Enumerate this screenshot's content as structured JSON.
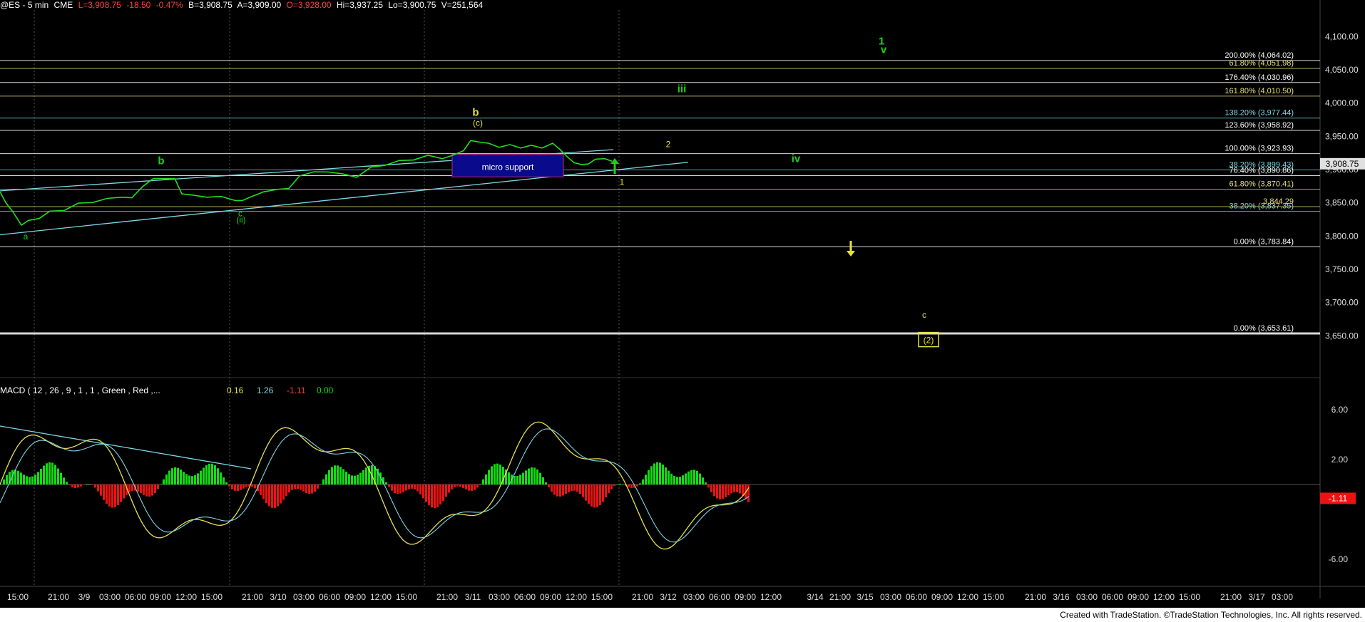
{
  "header": {
    "symbol": "@ES - 5 min",
    "exchange": "CME",
    "last": "L=3,908.75",
    "change": "-18.50",
    "change_pct": "-0.47%",
    "bid": "B=3,908.75",
    "ask": "A=3,909.00",
    "open": "O=3,928.00",
    "high": "Hi=3,937.25",
    "low": "Lo=3,900.75",
    "volume": "V=251,564"
  },
  "footer": {
    "credit": "Created with TradeStation. ©TradeStation Technologies, Inc. All rights reserved."
  },
  "colors": {
    "price": "#22dd22",
    "fib_white": "#ffffff",
    "fib_yellow": "#e8e07a",
    "fib_cyan": "#7fd6e6",
    "label_yellow": "#e8e03a",
    "label_green": "#1fcf1f",
    "macd_pos": "#11dd11",
    "macd_neg": "#ee1111",
    "support_box": "#0a0a8c",
    "support_border": "#c0306a"
  },
  "chart_data": [
    {
      "type": "line",
      "name": "price-panel",
      "ylim": [
        3600,
        4140
      ],
      "y_ticks": [
        "4,100.00",
        "4,050.00",
        "4,000.00",
        "3,950.00",
        "3,900.00",
        "3,850.00",
        "3,800.00",
        "3,750.00",
        "3,700.00",
        "3,650.00"
      ],
      "y_tick_values": [
        4100,
        4050,
        4000,
        3950,
        3900,
        3850,
        3800,
        3750,
        3700,
        3650
      ],
      "last_price_tag": "3,908.75",
      "price_series": [
        [
          0,
          3865
        ],
        [
          8,
          3852
        ],
        [
          18,
          3835
        ],
        [
          30,
          3818
        ],
        [
          40,
          3822
        ],
        [
          55,
          3828
        ],
        [
          70,
          3836
        ],
        [
          90,
          3840
        ],
        [
          110,
          3848
        ],
        [
          130,
          3852
        ],
        [
          150,
          3855
        ],
        [
          170,
          3860
        ],
        [
          185,
          3856
        ],
        [
          200,
          3876
        ],
        [
          215,
          3885
        ],
        [
          230,
          3888
        ],
        [
          245,
          3885
        ],
        [
          255,
          3865
        ],
        [
          270,
          3860
        ],
        [
          290,
          3860
        ],
        [
          310,
          3858
        ],
        [
          330,
          3855
        ],
        [
          340,
          3852
        ],
        [
          355,
          3862
        ],
        [
          370,
          3865
        ],
        [
          390,
          3872
        ],
        [
          405,
          3870
        ],
        [
          420,
          3892
        ],
        [
          440,
          3895
        ],
        [
          460,
          3898
        ],
        [
          480,
          3892
        ],
        [
          500,
          3890
        ],
        [
          520,
          3902
        ],
        [
          540,
          3908
        ],
        [
          560,
          3912
        ],
        [
          580,
          3916
        ],
        [
          600,
          3920
        ],
        [
          620,
          3918
        ],
        [
          635,
          3920
        ],
        [
          650,
          3930
        ],
        [
          660,
          3942
        ],
        [
          672,
          3943
        ],
        [
          685,
          3938
        ],
        [
          700,
          3935
        ],
        [
          715,
          3936
        ],
        [
          730,
          3934
        ],
        [
          745,
          3935
        ],
        [
          760,
          3934
        ],
        [
          775,
          3938
        ],
        [
          785,
          3932
        ],
        [
          795,
          3918
        ],
        [
          805,
          3912
        ],
        [
          815,
          3906
        ],
        [
          825,
          3910
        ],
        [
          835,
          3914
        ],
        [
          848,
          3918
        ],
        [
          858,
          3911
        ]
      ],
      "fib_levels": [
        {
          "label": "200.00% (4,064.02)",
          "value": 4064.02,
          "color": "white"
        },
        {
          "label": "61.80% (4,051.98)",
          "value": 4051.98,
          "color": "yellow"
        },
        {
          "label": "176.40% (4,030.96)",
          "value": 4030.96,
          "color": "white"
        },
        {
          "label": "161.80% (4,010.50)",
          "value": 4010.5,
          "color": "yellow"
        },
        {
          "label": "138.20% (3,977.44)",
          "value": 3977.44,
          "color": "cyan"
        },
        {
          "label": "123.60% (3,958.92)",
          "value": 3958.92,
          "color": "white"
        },
        {
          "label": "100.00% (3,923.93)",
          "value": 3923.93,
          "color": "white"
        },
        {
          "label": "38.20% (3,899.43)",
          "value": 3899.43,
          "color": "cyan"
        },
        {
          "label": "76.40% (3,890.86)",
          "value": 3890.86,
          "color": "white"
        },
        {
          "label": "61.80% (3,870.41)",
          "value": 3870.41,
          "color": "yellow"
        },
        {
          "label": "3,844.29",
          "value": 3844.29,
          "color": "yellow"
        },
        {
          "label": "38.20% (3,837.35)",
          "value": 3837.35,
          "color": "cyan"
        },
        {
          "label": "0.00% (3,783.84)",
          "value": 3783.84,
          "color": "white"
        },
        {
          "label": "0.00% (3,653.61)",
          "value": 3653.61,
          "color": "white"
        }
      ],
      "wave_labels": [
        {
          "text": "a",
          "color": "green",
          "x": 36,
          "y": 3795
        },
        {
          "text": "b",
          "color": "green",
          "x": 226,
          "y": 3908
        },
        {
          "text": "c",
          "color": "green",
          "x": 337,
          "y": 3830
        },
        {
          "text": "(ii)",
          "color": "green",
          "x": 338,
          "y": 3820
        },
        {
          "text": "b",
          "color": "yellow",
          "x": 667,
          "y": 3981
        },
        {
          "text": "(c)",
          "color": "yellow",
          "x": 670,
          "y": 3966
        },
        {
          "text": "2",
          "color": "yellow",
          "x": 937,
          "y": 3934
        },
        {
          "text": "1",
          "color": "yellow",
          "x": 872,
          "y": 3877
        },
        {
          "text": "iii",
          "color": "green",
          "x": 956,
          "y": 4016
        },
        {
          "text": "iv",
          "color": "green",
          "x": 1116,
          "y": 3911
        },
        {
          "text": "1",
          "color": "green",
          "x": 1236,
          "y": 4088
        },
        {
          "text": "v",
          "color": "green",
          "x": 1239,
          "y": 4075
        },
        {
          "text": "c",
          "color": "yellow",
          "x": 1296,
          "y": 3677
        },
        {
          "text": "(2)",
          "color": "yellow",
          "x": 1302,
          "y": 3639
        }
      ],
      "support_box": {
        "label": "micro support",
        "x0": 634,
        "x1": 790,
        "y_low": 3889,
        "y_high": 3923
      },
      "x_ticks": [
        "15:00",
        "21:00",
        "3/9",
        "03:00",
        "06:00",
        "09:00",
        "12:00",
        "15:00",
        "21:00",
        "3/10",
        "03:00",
        "06:00",
        "09:00",
        "12:00",
        "15:00",
        "21:00",
        "3/11",
        "03:00",
        "06:00",
        "09:00",
        "12:00",
        "15:00",
        "21:00",
        "3/12",
        "03:00",
        "06:00",
        "09:00",
        "12:00",
        "3/14",
        "21:00",
        "3/15",
        "03:00",
        "06:00",
        "09:00",
        "12:00",
        "15:00",
        "21:00",
        "3/16",
        "03:00",
        "06:00",
        "09:00",
        "12:00",
        "15:00",
        "21:00",
        "3/17",
        "03:00"
      ]
    },
    {
      "type": "bar",
      "name": "macd-panel",
      "title": "MACD ( 12 , 26 , 9 , 1 , 1 , Green , Red ,...",
      "values_text": [
        "0.16",
        "1.26",
        "-1.11",
        "0.00"
      ],
      "ylim": [
        -8,
        8
      ],
      "y_ticks": [
        "6.00",
        "2.00",
        "-6.00"
      ],
      "y_tick_values": [
        6,
        2,
        -6
      ],
      "last_tag": "-1.11"
    }
  ]
}
